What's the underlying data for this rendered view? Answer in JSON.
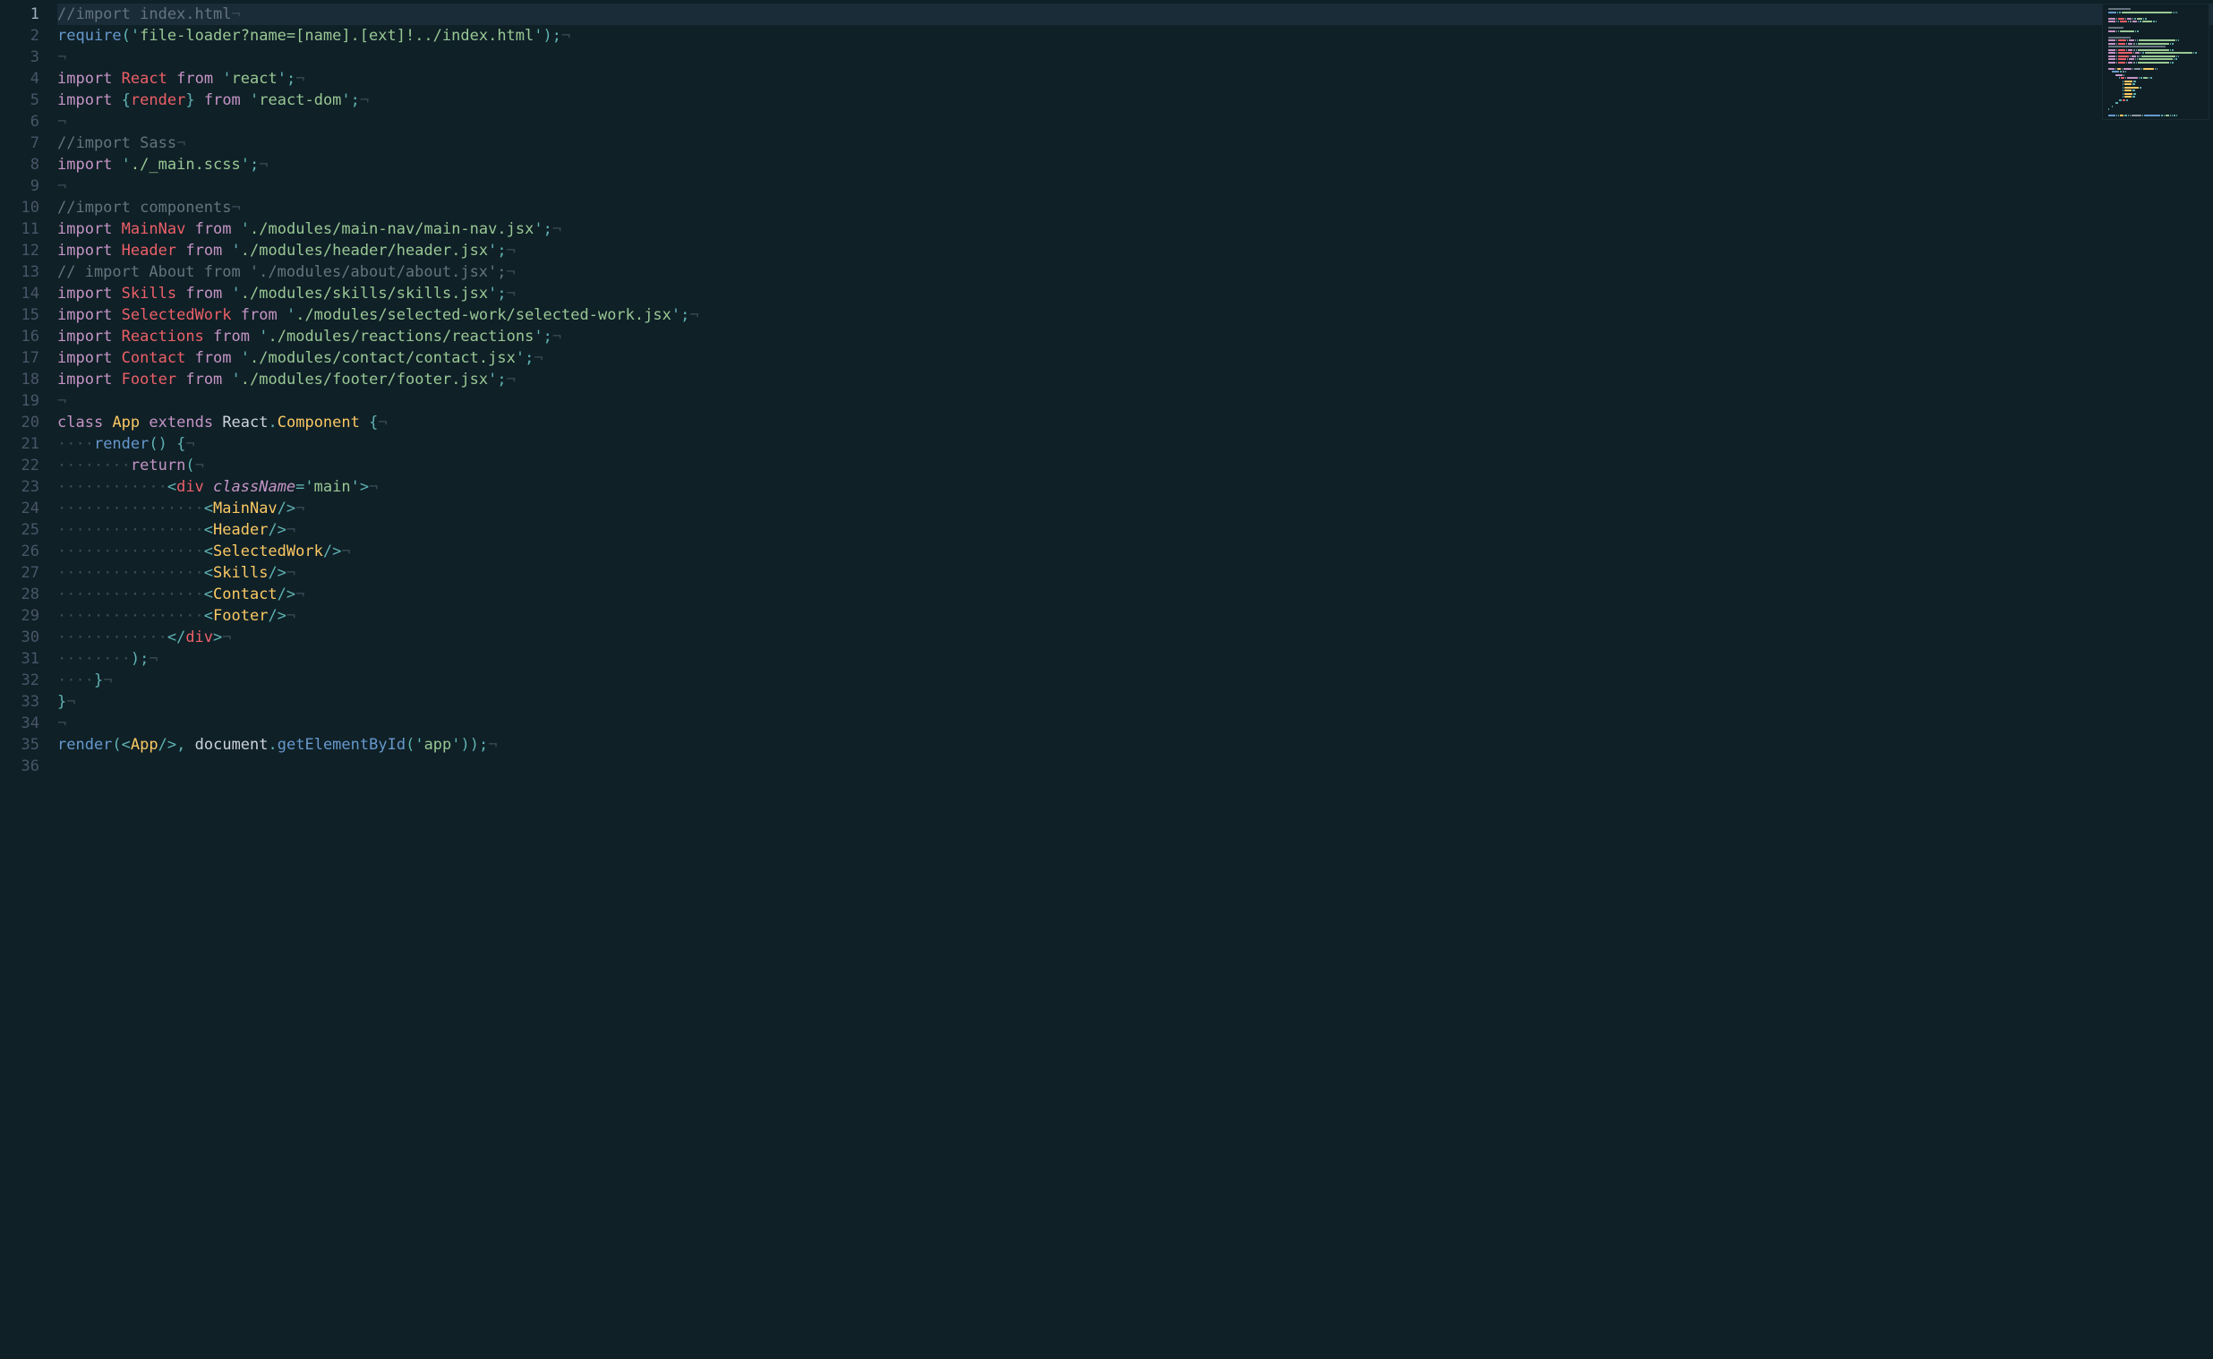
{
  "editor": {
    "active_line": 1,
    "lines": [
      {
        "num": 1,
        "tokens": [
          {
            "t": "//import index.html",
            "c": "comment"
          },
          {
            "t": "¬",
            "c": "eol"
          }
        ]
      },
      {
        "num": 2,
        "tokens": [
          {
            "t": "require",
            "c": "fn"
          },
          {
            "t": "(",
            "c": "punc"
          },
          {
            "t": "'",
            "c": "punc"
          },
          {
            "t": "file-loader?name=[name].[ext]!../index.html",
            "c": "str"
          },
          {
            "t": "'",
            "c": "punc"
          },
          {
            "t": ")",
            "c": "punc"
          },
          {
            "t": ";",
            "c": "punc"
          },
          {
            "t": "¬",
            "c": "eol"
          }
        ]
      },
      {
        "num": 3,
        "tokens": [
          {
            "t": "¬",
            "c": "eol"
          }
        ]
      },
      {
        "num": 4,
        "tokens": [
          {
            "t": "import",
            "c": "kw"
          },
          {
            "t": " ",
            "c": "plain"
          },
          {
            "t": "React",
            "c": "class"
          },
          {
            "t": " ",
            "c": "plain"
          },
          {
            "t": "from",
            "c": "kw"
          },
          {
            "t": " ",
            "c": "plain"
          },
          {
            "t": "'",
            "c": "punc"
          },
          {
            "t": "react",
            "c": "str"
          },
          {
            "t": "'",
            "c": "punc"
          },
          {
            "t": ";",
            "c": "punc"
          },
          {
            "t": "¬",
            "c": "eol"
          }
        ]
      },
      {
        "num": 5,
        "tokens": [
          {
            "t": "import",
            "c": "kw"
          },
          {
            "t": " ",
            "c": "plain"
          },
          {
            "t": "{",
            "c": "punc"
          },
          {
            "t": "render",
            "c": "class"
          },
          {
            "t": "}",
            "c": "punc"
          },
          {
            "t": " ",
            "c": "plain"
          },
          {
            "t": "from",
            "c": "kw"
          },
          {
            "t": " ",
            "c": "plain"
          },
          {
            "t": "'",
            "c": "punc"
          },
          {
            "t": "react-dom",
            "c": "str"
          },
          {
            "t": "'",
            "c": "punc"
          },
          {
            "t": ";",
            "c": "punc"
          },
          {
            "t": "¬",
            "c": "eol"
          }
        ]
      },
      {
        "num": 6,
        "tokens": [
          {
            "t": "¬",
            "c": "eol"
          }
        ]
      },
      {
        "num": 7,
        "tokens": [
          {
            "t": "//import Sass",
            "c": "comment"
          },
          {
            "t": "¬",
            "c": "eol"
          }
        ]
      },
      {
        "num": 8,
        "tokens": [
          {
            "t": "import",
            "c": "kw"
          },
          {
            "t": " ",
            "c": "plain"
          },
          {
            "t": "'",
            "c": "punc"
          },
          {
            "t": "./_main.scss",
            "c": "str"
          },
          {
            "t": "'",
            "c": "punc"
          },
          {
            "t": ";",
            "c": "punc"
          },
          {
            "t": "¬",
            "c": "eol"
          }
        ]
      },
      {
        "num": 9,
        "tokens": [
          {
            "t": "¬",
            "c": "eol"
          }
        ]
      },
      {
        "num": 10,
        "tokens": [
          {
            "t": "//import components",
            "c": "comment"
          },
          {
            "t": "¬",
            "c": "eol"
          }
        ]
      },
      {
        "num": 11,
        "tokens": [
          {
            "t": "import",
            "c": "kw"
          },
          {
            "t": " ",
            "c": "plain"
          },
          {
            "t": "MainNav",
            "c": "class"
          },
          {
            "t": " ",
            "c": "plain"
          },
          {
            "t": "from",
            "c": "kw"
          },
          {
            "t": " ",
            "c": "plain"
          },
          {
            "t": "'",
            "c": "punc"
          },
          {
            "t": "./modules/main-nav/main-nav.jsx",
            "c": "str"
          },
          {
            "t": "'",
            "c": "punc"
          },
          {
            "t": ";",
            "c": "punc"
          },
          {
            "t": "¬",
            "c": "eol"
          }
        ]
      },
      {
        "num": 12,
        "tokens": [
          {
            "t": "import",
            "c": "kw"
          },
          {
            "t": " ",
            "c": "plain"
          },
          {
            "t": "Header",
            "c": "class"
          },
          {
            "t": " ",
            "c": "plain"
          },
          {
            "t": "from",
            "c": "kw"
          },
          {
            "t": " ",
            "c": "plain"
          },
          {
            "t": "'",
            "c": "punc"
          },
          {
            "t": "./modules/header/header.jsx",
            "c": "str"
          },
          {
            "t": "'",
            "c": "punc"
          },
          {
            "t": ";",
            "c": "punc"
          },
          {
            "t": "¬",
            "c": "eol"
          }
        ]
      },
      {
        "num": 13,
        "tokens": [
          {
            "t": "// import About from './modules/about/about.jsx';",
            "c": "comment"
          },
          {
            "t": "¬",
            "c": "eol"
          }
        ]
      },
      {
        "num": 14,
        "tokens": [
          {
            "t": "import",
            "c": "kw"
          },
          {
            "t": " ",
            "c": "plain"
          },
          {
            "t": "Skills",
            "c": "class"
          },
          {
            "t": " ",
            "c": "plain"
          },
          {
            "t": "from",
            "c": "kw"
          },
          {
            "t": " ",
            "c": "plain"
          },
          {
            "t": "'",
            "c": "punc"
          },
          {
            "t": "./modules/skills/skills.jsx",
            "c": "str"
          },
          {
            "t": "'",
            "c": "punc"
          },
          {
            "t": ";",
            "c": "punc"
          },
          {
            "t": "¬",
            "c": "eol"
          }
        ]
      },
      {
        "num": 15,
        "tokens": [
          {
            "t": "import",
            "c": "kw"
          },
          {
            "t": " ",
            "c": "plain"
          },
          {
            "t": "SelectedWork",
            "c": "class"
          },
          {
            "t": " ",
            "c": "plain"
          },
          {
            "t": "from",
            "c": "kw"
          },
          {
            "t": " ",
            "c": "plain"
          },
          {
            "t": "'",
            "c": "punc"
          },
          {
            "t": "./modules/selected-work/selected-work.jsx",
            "c": "str"
          },
          {
            "t": "'",
            "c": "punc"
          },
          {
            "t": ";",
            "c": "punc"
          },
          {
            "t": "¬",
            "c": "eol"
          }
        ]
      },
      {
        "num": 16,
        "tokens": [
          {
            "t": "import",
            "c": "kw"
          },
          {
            "t": " ",
            "c": "plain"
          },
          {
            "t": "Reactions",
            "c": "class"
          },
          {
            "t": " ",
            "c": "plain"
          },
          {
            "t": "from",
            "c": "kw"
          },
          {
            "t": " ",
            "c": "plain"
          },
          {
            "t": "'",
            "c": "punc"
          },
          {
            "t": "./modules/reactions/reactions",
            "c": "str"
          },
          {
            "t": "'",
            "c": "punc"
          },
          {
            "t": ";",
            "c": "punc"
          },
          {
            "t": "¬",
            "c": "eol"
          }
        ]
      },
      {
        "num": 17,
        "tokens": [
          {
            "t": "import",
            "c": "kw"
          },
          {
            "t": " ",
            "c": "plain"
          },
          {
            "t": "Contact",
            "c": "class"
          },
          {
            "t": " ",
            "c": "plain"
          },
          {
            "t": "from",
            "c": "kw"
          },
          {
            "t": " ",
            "c": "plain"
          },
          {
            "t": "'",
            "c": "punc"
          },
          {
            "t": "./modules/contact/contact.jsx",
            "c": "str"
          },
          {
            "t": "'",
            "c": "punc"
          },
          {
            "t": ";",
            "c": "punc"
          },
          {
            "t": "¬",
            "c": "eol"
          }
        ]
      },
      {
        "num": 18,
        "tokens": [
          {
            "t": "import",
            "c": "kw"
          },
          {
            "t": " ",
            "c": "plain"
          },
          {
            "t": "Footer",
            "c": "class"
          },
          {
            "t": " ",
            "c": "plain"
          },
          {
            "t": "from",
            "c": "kw"
          },
          {
            "t": " ",
            "c": "plain"
          },
          {
            "t": "'",
            "c": "punc"
          },
          {
            "t": "./modules/footer/footer.jsx",
            "c": "str"
          },
          {
            "t": "'",
            "c": "punc"
          },
          {
            "t": ";",
            "c": "punc"
          },
          {
            "t": "¬",
            "c": "eol"
          }
        ]
      },
      {
        "num": 19,
        "tokens": [
          {
            "t": "¬",
            "c": "eol"
          }
        ]
      },
      {
        "num": 20,
        "tokens": [
          {
            "t": "class",
            "c": "kw"
          },
          {
            "t": " ",
            "c": "plain"
          },
          {
            "t": "App",
            "c": "entity"
          },
          {
            "t": " ",
            "c": "plain"
          },
          {
            "t": "extends",
            "c": "kw"
          },
          {
            "t": " ",
            "c": "plain"
          },
          {
            "t": "React",
            "c": "plain"
          },
          {
            "t": ".",
            "c": "punc"
          },
          {
            "t": "Component",
            "c": "entity"
          },
          {
            "t": " ",
            "c": "plain"
          },
          {
            "t": "{",
            "c": "punc"
          },
          {
            "t": "¬",
            "c": "eol"
          }
        ]
      },
      {
        "num": 21,
        "tokens": [
          {
            "t": "····",
            "c": "ws"
          },
          {
            "t": "render",
            "c": "fn"
          },
          {
            "t": "()",
            "c": "punc"
          },
          {
            "t": " ",
            "c": "plain"
          },
          {
            "t": "{",
            "c": "punc"
          },
          {
            "t": "¬",
            "c": "eol"
          }
        ]
      },
      {
        "num": 22,
        "tokens": [
          {
            "t": "········",
            "c": "ws"
          },
          {
            "t": "return",
            "c": "kw"
          },
          {
            "t": "(",
            "c": "punc"
          },
          {
            "t": "¬",
            "c": "eol"
          }
        ]
      },
      {
        "num": 23,
        "tokens": [
          {
            "t": "············",
            "c": "ws"
          },
          {
            "t": "<",
            "c": "punc"
          },
          {
            "t": "div",
            "c": "tag"
          },
          {
            "t": " ",
            "c": "plain"
          },
          {
            "t": "className",
            "c": "attr"
          },
          {
            "t": "=",
            "c": "punc"
          },
          {
            "t": "'",
            "c": "punc"
          },
          {
            "t": "main",
            "c": "str"
          },
          {
            "t": "'",
            "c": "punc"
          },
          {
            "t": ">",
            "c": "punc"
          },
          {
            "t": "¬",
            "c": "eol"
          }
        ]
      },
      {
        "num": 24,
        "tokens": [
          {
            "t": "················",
            "c": "ws"
          },
          {
            "t": "<",
            "c": "punc"
          },
          {
            "t": "MainNav",
            "c": "entity"
          },
          {
            "t": "/>",
            "c": "punc"
          },
          {
            "t": "¬",
            "c": "eol"
          }
        ]
      },
      {
        "num": 25,
        "tokens": [
          {
            "t": "················",
            "c": "ws"
          },
          {
            "t": "<",
            "c": "punc"
          },
          {
            "t": "Header",
            "c": "entity"
          },
          {
            "t": "/>",
            "c": "punc"
          },
          {
            "t": "¬",
            "c": "eol"
          }
        ]
      },
      {
        "num": 26,
        "tokens": [
          {
            "t": "················",
            "c": "ws"
          },
          {
            "t": "<",
            "c": "punc"
          },
          {
            "t": "SelectedWork",
            "c": "entity"
          },
          {
            "t": "/>",
            "c": "punc"
          },
          {
            "t": "¬",
            "c": "eol"
          }
        ]
      },
      {
        "num": 27,
        "tokens": [
          {
            "t": "················",
            "c": "ws"
          },
          {
            "t": "<",
            "c": "punc"
          },
          {
            "t": "Skills",
            "c": "entity"
          },
          {
            "t": "/>",
            "c": "punc"
          },
          {
            "t": "¬",
            "c": "eol"
          }
        ]
      },
      {
        "num": 28,
        "tokens": [
          {
            "t": "················",
            "c": "ws"
          },
          {
            "t": "<",
            "c": "punc"
          },
          {
            "t": "Contact",
            "c": "entity"
          },
          {
            "t": "/>",
            "c": "punc"
          },
          {
            "t": "¬",
            "c": "eol"
          }
        ]
      },
      {
        "num": 29,
        "tokens": [
          {
            "t": "················",
            "c": "ws"
          },
          {
            "t": "<",
            "c": "punc"
          },
          {
            "t": "Footer",
            "c": "entity"
          },
          {
            "t": "/>",
            "c": "punc"
          },
          {
            "t": "¬",
            "c": "eol"
          }
        ]
      },
      {
        "num": 30,
        "tokens": [
          {
            "t": "············",
            "c": "ws"
          },
          {
            "t": "</",
            "c": "punc"
          },
          {
            "t": "div",
            "c": "tag"
          },
          {
            "t": ">",
            "c": "punc"
          },
          {
            "t": "¬",
            "c": "eol"
          }
        ]
      },
      {
        "num": 31,
        "tokens": [
          {
            "t": "········",
            "c": "ws"
          },
          {
            "t": ");",
            "c": "punc"
          },
          {
            "t": "¬",
            "c": "eol"
          }
        ]
      },
      {
        "num": 32,
        "tokens": [
          {
            "t": "····",
            "c": "ws"
          },
          {
            "t": "}",
            "c": "punc"
          },
          {
            "t": "¬",
            "c": "eol"
          }
        ]
      },
      {
        "num": 33,
        "tokens": [
          {
            "t": "}",
            "c": "punc"
          },
          {
            "t": "¬",
            "c": "eol"
          }
        ]
      },
      {
        "num": 34,
        "tokens": [
          {
            "t": "¬",
            "c": "eol"
          }
        ]
      },
      {
        "num": 35,
        "tokens": [
          {
            "t": "render",
            "c": "fn"
          },
          {
            "t": "(",
            "c": "punc"
          },
          {
            "t": "<",
            "c": "punc"
          },
          {
            "t": "App",
            "c": "entity"
          },
          {
            "t": "/>",
            "c": "punc"
          },
          {
            "t": ",",
            "c": "punc"
          },
          {
            "t": " ",
            "c": "plain"
          },
          {
            "t": "document",
            "c": "plain"
          },
          {
            "t": ".",
            "c": "punc"
          },
          {
            "t": "getElementById",
            "c": "fn"
          },
          {
            "t": "(",
            "c": "punc"
          },
          {
            "t": "'",
            "c": "punc"
          },
          {
            "t": "app",
            "c": "str"
          },
          {
            "t": "'",
            "c": "punc"
          },
          {
            "t": ")",
            "c": "punc"
          },
          {
            "t": ")",
            "c": "punc"
          },
          {
            "t": ";",
            "c": "punc"
          },
          {
            "t": "¬",
            "c": "eol"
          }
        ]
      },
      {
        "num": 36,
        "tokens": []
      }
    ]
  }
}
